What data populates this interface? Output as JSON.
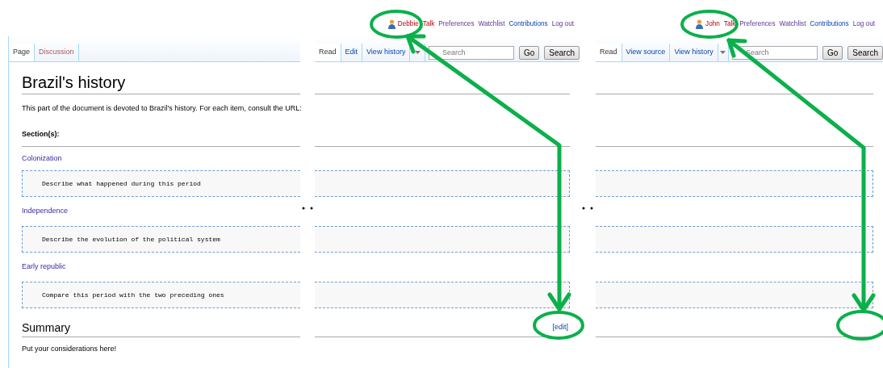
{
  "article": {
    "tabs": [
      {
        "label": "Page",
        "selected": true
      },
      {
        "label": "Discussion",
        "selected": false
      }
    ],
    "title": "Brazil's history",
    "intro": "This part of the document is devoted to Brazil's history. For each item, consult the URL:",
    "sections_heading": "Section(s):",
    "sections": [
      {
        "link": "Colonization",
        "prompt": "Describe what happened during this period"
      },
      {
        "link": "Independence",
        "prompt": "Describe the evolution of the political system"
      },
      {
        "link": "Early republic",
        "prompt": "Compare this period with the two preceding ones"
      }
    ],
    "summary_heading": "Summary",
    "summary_text": "Put your considerations here!"
  },
  "views": [
    {
      "user": "Debbie",
      "personal_links": [
        {
          "label": "Talk",
          "kind": "new"
        },
        {
          "label": "Preferences",
          "kind": "visited"
        },
        {
          "label": "Watchlist",
          "kind": "visited"
        },
        {
          "label": "Contributions",
          "kind": "normal"
        },
        {
          "label": "Log out",
          "kind": "visited"
        }
      ],
      "view_tabs": [
        {
          "label": "Read",
          "selected": true
        },
        {
          "label": "Edit",
          "selected": false
        },
        {
          "label": "View history",
          "selected": false
        }
      ],
      "search": {
        "placeholder": "Search"
      },
      "buttons": [
        "Go",
        "Search"
      ],
      "summary_edit_link": "[edit]"
    },
    {
      "user": "John",
      "personal_links": [
        {
          "label": "Talk",
          "kind": "new"
        },
        {
          "label": "Preferences",
          "kind": "visited"
        },
        {
          "label": "Watchlist",
          "kind": "visited"
        },
        {
          "label": "Contributions",
          "kind": "normal"
        },
        {
          "label": "Log out",
          "kind": "visited"
        }
      ],
      "view_tabs": [
        {
          "label": "Read",
          "selected": true
        },
        {
          "label": "View source",
          "selected": false
        },
        {
          "label": "View history",
          "selected": false
        }
      ],
      "search": {
        "placeholder": "Search"
      },
      "buttons": [
        "Go",
        "Search"
      ]
    }
  ]
}
